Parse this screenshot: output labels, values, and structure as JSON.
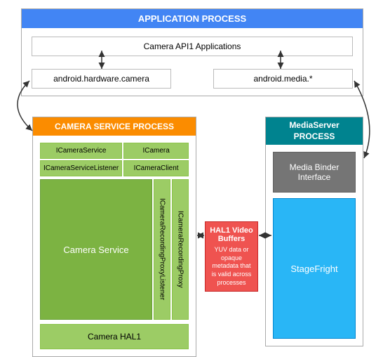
{
  "app_process": {
    "title": "APPLICATION PROCESS",
    "api_box": "Camera API1 Applications",
    "hw_camera": "android.hardware.camera",
    "media": "android.media.*"
  },
  "camera_service": {
    "title": "CAMERA SERVICE PROCESS",
    "icameraservice": "ICameraService",
    "icamera": "ICamera",
    "icameraservicelistener": "ICameraServiceListener",
    "icameraclient": "ICameraClient",
    "service": "Camera Service",
    "proxy_listener": "ICameraRecordingProxyListener",
    "proxy": "ICameraRecordingProxy",
    "hal": "Camera HAL1"
  },
  "mediaserver": {
    "title": "MediaServer PROCESS",
    "binder": "Media Binder Interface",
    "stagefright": "StageFright"
  },
  "hal_buf": {
    "title": "HAL1 Video Buffers",
    "desc": "YUV data or opaque metadata that is valid across processes"
  }
}
